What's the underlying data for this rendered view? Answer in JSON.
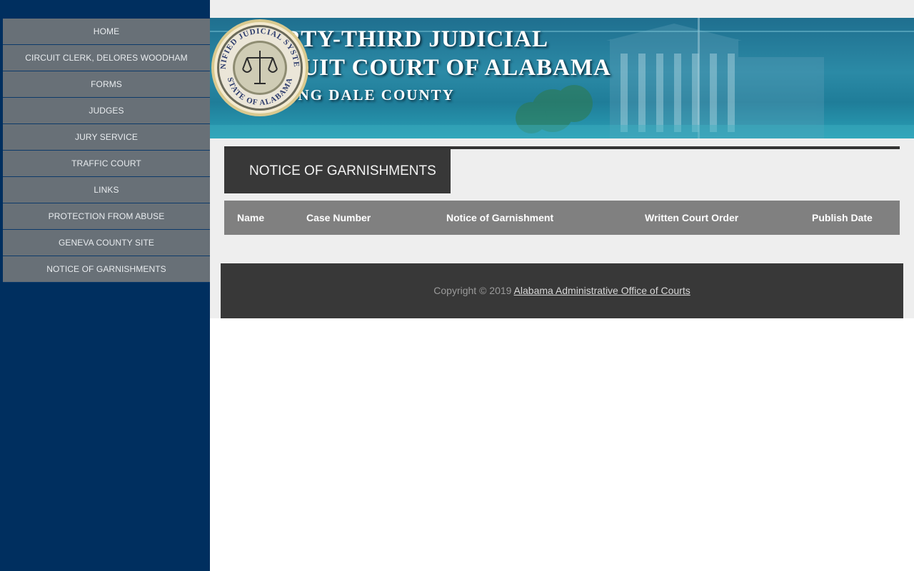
{
  "sidebar": {
    "items": [
      {
        "label": "HOME"
      },
      {
        "label": "CIRCUIT CLERK, DELORES WOODHAM"
      },
      {
        "label": "FORMS"
      },
      {
        "label": "JUDGES"
      },
      {
        "label": "JURY SERVICE"
      },
      {
        "label": "TRAFFIC COURT"
      },
      {
        "label": "LINKS"
      },
      {
        "label": "PROTECTION FROM ABUSE"
      },
      {
        "label": "GENEVA COUNTY SITE"
      },
      {
        "label": "NOTICE OF GARNISHMENTS"
      }
    ]
  },
  "banner": {
    "line1": "THIRTY-THIRD JUDICIAL",
    "line2": "CIRCUIT COURT OF ALABAMA",
    "line3": "SERVING DALE COUNTY",
    "seal_top": "UNIFIED JUDICIAL SYSTEM",
    "seal_bottom": "STATE OF ALABAMA"
  },
  "section": {
    "title": "NOTICE OF GARNISHMENTS"
  },
  "table": {
    "headers": [
      "Name",
      "Case Number",
      "Notice of Garnishment",
      "Written Court Order",
      "Publish Date"
    ]
  },
  "footer": {
    "copyright": "Copyright © 2019",
    "link_text": "Alabama Administrative Office of Courts"
  },
  "colors": {
    "sidebar_bg": "#002f5f",
    "nav_item_bg": "#687077",
    "main_bg": "#eeeeee",
    "dark_panel": "#383838",
    "table_head": "#808080"
  }
}
